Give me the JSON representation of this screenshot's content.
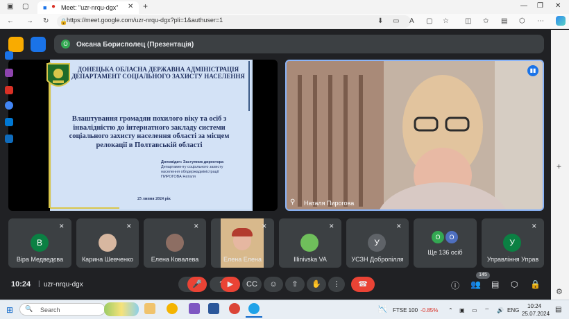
{
  "browser": {
    "tab_title": "Meet: \"uzr-nrqu-dgx\"",
    "url": "https://meet.google.com/uzr-nrqu-dgx?pli=1&authuser=1"
  },
  "meet": {
    "presenter_initial": "О",
    "presenter_label": "Оксана Борисполец (Презентація)",
    "slide": {
      "header1": "ДОНЕЦЬКА ОБЛАСНА ДЕРЖАВНА АДМІНІСТРАЦІЯ",
      "header2": "ДЕПАРТАМЕНТ СОЦІАЛЬНОГО ЗАХИСТУ НАСЕЛЕННЯ",
      "title": "Влаштування громадян похилого віку та осіб з інвалідністю до інтернатного закладу системи соціального захисту населення області за місцем релокації в Полтавській області",
      "speaker_line1": "Доповідач: Заступник директора",
      "speaker_line2": "Департаменту соціального захисту",
      "speaker_line3": "населення облдержадміністрації",
      "speaker_line4": "ПИРОГОВА Наталя",
      "date": "25 липня 2024 рік"
    },
    "speaker_name": "Наталя Пирогова",
    "tiles": [
      {
        "name": "Віра Медведєва",
        "initial": "В",
        "color": "#0b8043"
      },
      {
        "name": "Карина Шевченко",
        "initial": "",
        "color": "#5f6368"
      },
      {
        "name": "Елена Ковалева",
        "initial": "",
        "color": "#5f6368"
      },
      {
        "name": "Елена Елена",
        "initial": "",
        "color": "#5f6368"
      },
      {
        "name": "Illinivska VA",
        "initial": "",
        "color": "#5f6368"
      },
      {
        "name": "УСЗН Добропілля",
        "initial": "У",
        "color": "#5f6368"
      },
      {
        "name": "Ще 136 осіб",
        "initial": "",
        "color": "#5f6368"
      },
      {
        "name": "Управління Управ",
        "initial": "У",
        "color": "#0b8043"
      }
    ],
    "more_avatars": [
      "О",
      "О"
    ],
    "time": "10:24",
    "meeting_code": "uzr-nrqu-dgx",
    "participants_count": "145"
  },
  "taskbar": {
    "search_placeholder": "Search",
    "ticker": "FTSE 100",
    "ticker_change": "-0.85%",
    "lang": "ENG",
    "time": "10:24",
    "date": "25.07.2024"
  },
  "colors": {
    "meet_bg": "#202124",
    "tile_bg": "#3c4043",
    "end_call": "#ea4335",
    "accent_blue": "#8ab4f8"
  }
}
